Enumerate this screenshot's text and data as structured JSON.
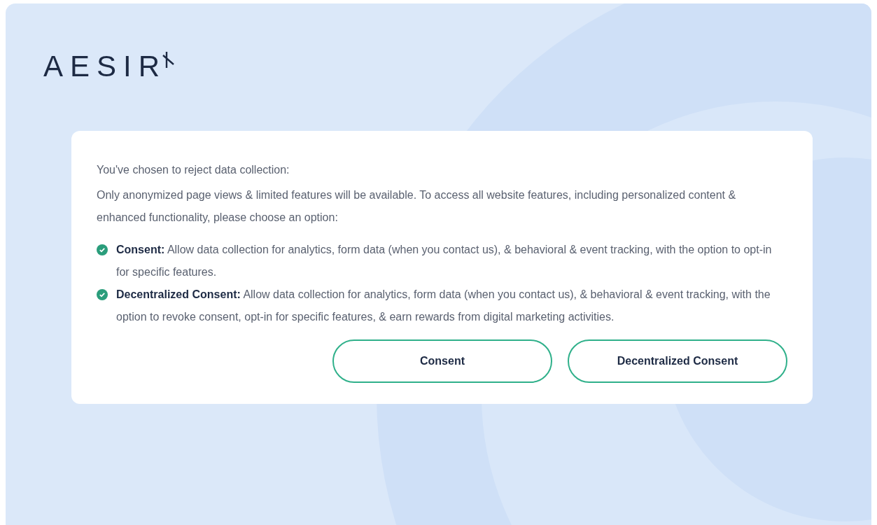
{
  "logo": {
    "text": "AESIR"
  },
  "notice": {
    "heading": "You've chosen to reject data collection:",
    "body": "Only anonymized page views & limited features will be available. To access all website features, including personalized content & enhanced functionality, please choose an option:",
    "options": [
      {
        "title": "Consent:",
        "text": "Allow data collection for analytics, form data (when you contact us), & behavioral & event tracking, with the option to opt-in for specific features.",
        "checked": true
      },
      {
        "title": "Decentralized Consent:",
        "text": "Allow data collection for analytics, form data (when you contact us), & behavioral & event tracking, with the option to revoke consent, opt-in for specific features, & earn rewards from digital marketing activities.",
        "checked": true
      }
    ],
    "buttons": [
      "Consent",
      "Decentralized Consent"
    ]
  }
}
